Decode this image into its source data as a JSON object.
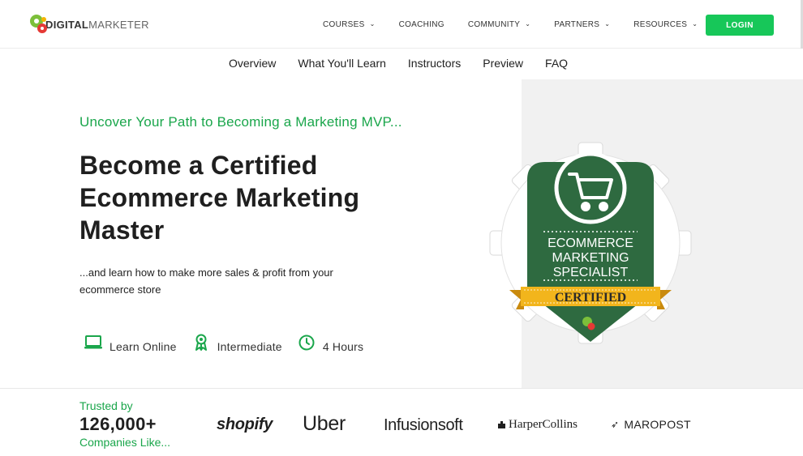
{
  "header": {
    "logo": {
      "part1": "DIGITAL",
      "part2": "MARKETER"
    },
    "nav": [
      {
        "label": "COURSES",
        "has_dropdown": true
      },
      {
        "label": "COACHING",
        "has_dropdown": false
      },
      {
        "label": "COMMUNITY",
        "has_dropdown": true
      },
      {
        "label": "PARTNERS",
        "has_dropdown": true
      },
      {
        "label": "RESOURCES",
        "has_dropdown": true
      }
    ],
    "login_label": "LOGIN"
  },
  "subnav": [
    "Overview",
    "What You'll Learn",
    "Instructors",
    "Preview",
    "FAQ"
  ],
  "hero": {
    "eyebrow": "Uncover Your Path to Becoming a Marketing MVP...",
    "headline": "Become a Certified Ecommerce Marketing Master",
    "subheadline": "...and learn how to make more sales & profit from your ecommerce store",
    "features": [
      {
        "icon": "laptop-icon",
        "label": "Learn Online"
      },
      {
        "icon": "award-ribbon-icon",
        "label": "Intermediate"
      },
      {
        "icon": "clock-icon",
        "label": "4 Hours"
      }
    ]
  },
  "badge": {
    "line1": "ECOMMERCE",
    "line2": "MARKETING",
    "line3": "SPECIALIST",
    "ribbon": "CERTIFIED",
    "icon": "shopping-cart-icon"
  },
  "trusted": {
    "line1": "Trusted by",
    "count": "126,000+",
    "line3": "Companies Like...",
    "brands": [
      "shopify",
      "Uber",
      "Infusionsoft",
      "HarperCollins",
      "MAROPOST"
    ]
  },
  "colors": {
    "accent_green": "#17c759",
    "text_green": "#1aa64b",
    "badge_green": "#2e6a40",
    "ribbon_gold": "#f2b51c"
  }
}
